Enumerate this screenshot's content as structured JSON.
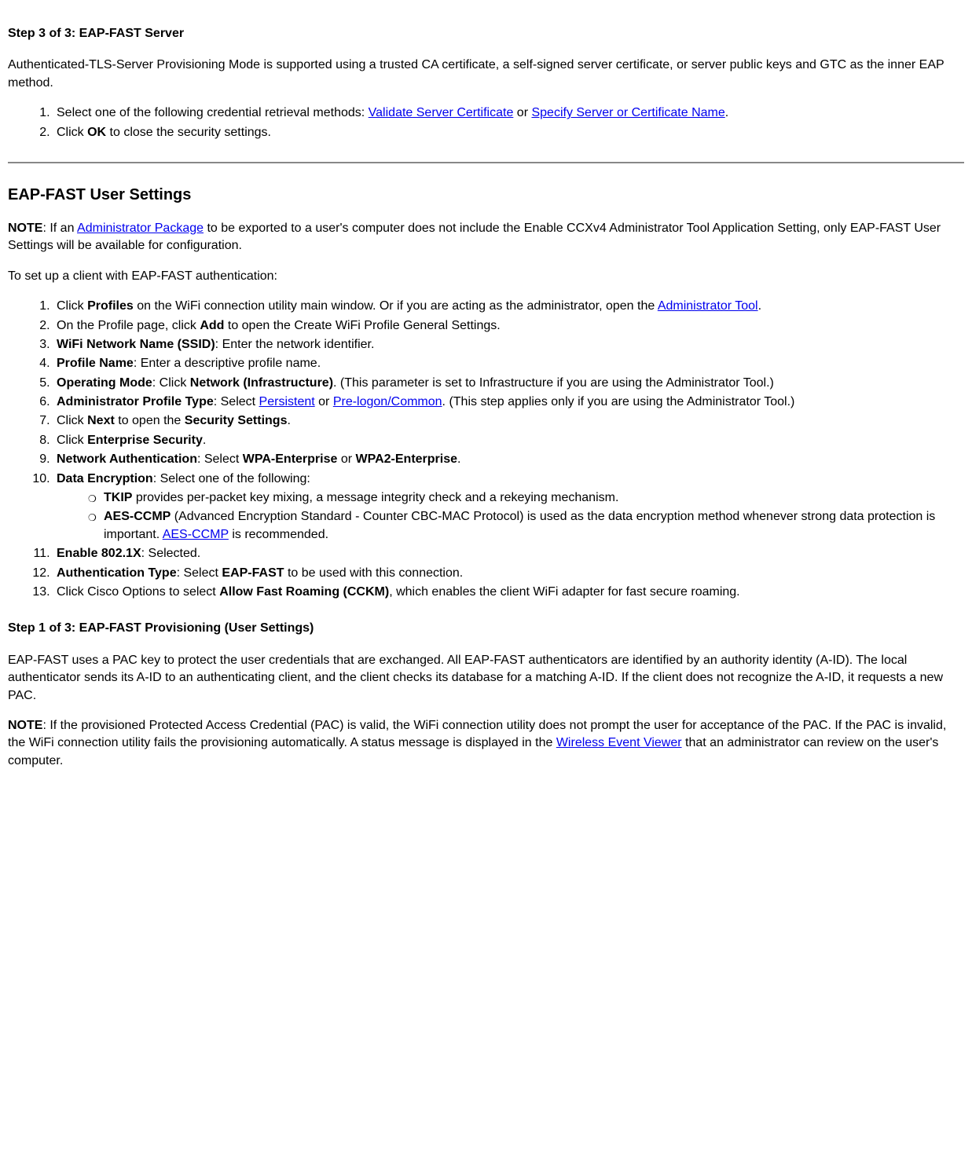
{
  "step3": {
    "heading": "Step 3 of 3: EAP-FAST Server",
    "para": "Authenticated-TLS-Server Provisioning Mode is supported using a trusted CA certificate, a self-signed server certificate, or server public keys and GTC as the inner EAP method.",
    "li1_pre": "Select one of the following credential retrieval methods: ",
    "li1_link1": "Validate Server Certificate",
    "li1_mid": " or ",
    "li1_link2": "Specify Server or Certificate Name",
    "li1_post": ".",
    "li2_pre": "Click ",
    "li2_bold": "OK",
    "li2_post": " to close the security settings."
  },
  "userSettings": {
    "heading": "EAP-FAST User Settings",
    "note_bold": "NOTE",
    "note_pre": ": If an ",
    "note_link": "Administrator Package",
    "note_post": " to be exported to a user's computer does not include the Enable CCXv4 Administrator Tool Application Setting, only EAP-FAST User Settings will be available for configuration.",
    "setup_intro": "To set up a client with EAP-FAST authentication:",
    "li1_pre": "Click ",
    "li1_bold": "Profiles",
    "li1_mid": " on the WiFi connection utility main window. Or if you are acting as the administrator, open the ",
    "li1_link": "Administrator Tool",
    "li1_post": ".",
    "li2_pre": "On the Profile page, click ",
    "li2_bold": "Add",
    "li2_post": " to open the Create WiFi Profile General Settings.",
    "li3_bold": "WiFi Network Name (SSID)",
    "li3_post": ": Enter the network identifier.",
    "li4_bold": "Profile Name",
    "li4_post": ": Enter a descriptive profile name.",
    "li5_bold1": "Operating Mode",
    "li5_mid": ": Click ",
    "li5_bold2": "Network (Infrastructure)",
    "li5_post": ". (This parameter is set to Infrastructure if you are using the Administrator Tool.)",
    "li6_bold": "Administrator Profile Type",
    "li6_mid1": ": Select ",
    "li6_link1": "Persistent",
    "li6_mid2": " or ",
    "li6_link2": "Pre-logon/Common",
    "li6_post": ". (This step applies only if you are using the Administrator Tool.)",
    "li7_pre": "Click ",
    "li7_bold1": "Next",
    "li7_mid": " to open the ",
    "li7_bold2": "Security Settings",
    "li7_post": ".",
    "li8_pre": "Click ",
    "li8_bold": "Enterprise Security",
    "li8_post": ".",
    "li9_bold1": "Network Authentication",
    "li9_mid1": ": Select ",
    "li9_bold2": "WPA-Enterprise",
    "li9_mid2": " or ",
    "li9_bold3": "WPA2-Enterprise",
    "li9_post": ".",
    "li10_bold": "Data Encryption",
    "li10_post": ": Select one of the following:",
    "li10a_bold": "TKIP",
    "li10a_post": " provides per-packet key mixing, a message integrity check and a rekeying mechanism.",
    "li10b_bold": "AES-CCMP",
    "li10b_mid": " (Advanced Encryption Standard - Counter CBC-MAC Protocol) is used as the data encryption method whenever strong data protection is important. ",
    "li10b_link": "AES-CCMP",
    "li10b_post": " is recommended.",
    "li11_bold": "Enable 802.1X",
    "li11_post": ": Selected.",
    "li12_bold1": "Authentication Type",
    "li12_mid": ": Select ",
    "li12_bold2": "EAP-FAST",
    "li12_post": " to be used with this connection.",
    "li13_pre": "Click Cisco Options to select ",
    "li13_bold": "Allow Fast Roaming (CCKM)",
    "li13_post": ", which enables the client WiFi adapter for fast secure roaming."
  },
  "step1": {
    "heading": "Step 1 of 3: EAP-FAST Provisioning (User Settings)",
    "para": "EAP-FAST uses a PAC key to protect the user credentials that are exchanged. All EAP-FAST authenticators are identified by an authority identity (A-ID). The local authenticator sends its A-ID to an authenticating client, and the client checks its database for a matching A-ID. If the client does not recognize the A-ID, it requests a new PAC.",
    "note_bold": "NOTE",
    "note_pre": ": If the provisioned Protected Access Credential (PAC) is valid, the WiFi connection utility does not prompt the user for acceptance of the PAC. If the PAC is invalid, the WiFi connection utility fails the provisioning automatically. A status message is displayed in the ",
    "note_link": "Wireless Event Viewer",
    "note_post": " that an administrator can review on the user's computer."
  }
}
